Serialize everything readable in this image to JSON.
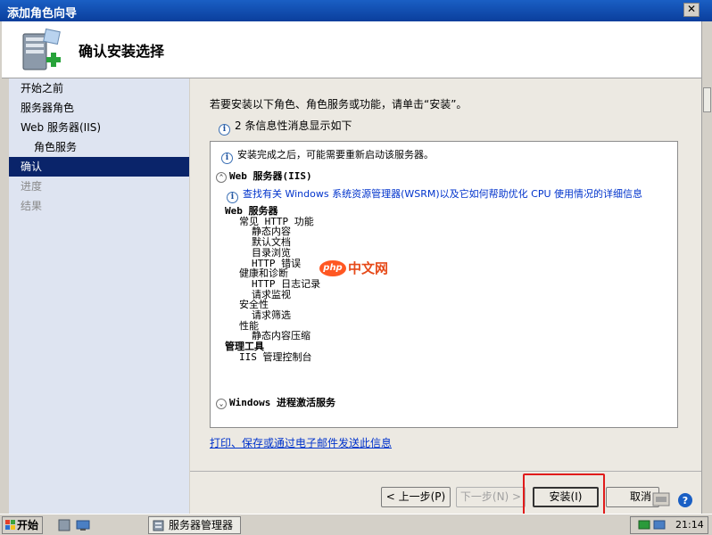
{
  "window": {
    "title": "添加角色向导",
    "close_glyph": "✕"
  },
  "header": {
    "title": "确认安装选择",
    "icon": "server-add-icon"
  },
  "nav": {
    "items": [
      {
        "label": "开始之前",
        "state": "normal"
      },
      {
        "label": "服务器角色",
        "state": "normal"
      },
      {
        "label": "Web 服务器(IIS)",
        "state": "normal"
      },
      {
        "label": "角色服务",
        "state": "sub"
      },
      {
        "label": "确认",
        "state": "active"
      },
      {
        "label": "进度",
        "state": "disabled"
      },
      {
        "label": "结果",
        "state": "disabled"
      }
    ]
  },
  "main": {
    "intro": "若要安装以下角色、角色服务或功能，请单击“安装”。",
    "info_count": "2 条信息性消息显示如下",
    "restart_note": "安装完成之后，可能需要重新启动该服务器。",
    "section_iis": "Web 服务器(IIS)",
    "wsrm_link": "查找有关 Windows 系统资源管理器(WSRM)以及它如何帮助优化 CPU 使用情况的详细信息",
    "tree": [
      {
        "level": 0,
        "text": "Web 服务器"
      },
      {
        "level": 1,
        "text": "常见 HTTP 功能"
      },
      {
        "level": 2,
        "text": "静态内容"
      },
      {
        "level": 2,
        "text": "默认文档"
      },
      {
        "level": 2,
        "text": "目录浏览"
      },
      {
        "level": 2,
        "text": "HTTP 错误"
      },
      {
        "level": 1,
        "text": "健康和诊断"
      },
      {
        "level": 2,
        "text": "HTTP 日志记录"
      },
      {
        "level": 2,
        "text": "请求监视"
      },
      {
        "level": 1,
        "text": "安全性"
      },
      {
        "level": 2,
        "text": "请求筛选"
      },
      {
        "level": 1,
        "text": "性能"
      },
      {
        "level": 2,
        "text": "静态内容压缩"
      },
      {
        "level": 0,
        "text": "管理工具"
      },
      {
        "level": 1,
        "text": "IIS 管理控制台"
      }
    ],
    "section_was": "Windows 进程激活服务",
    "print_link": "打印、保存或通过电子邮件发送此信息"
  },
  "footer": {
    "prev": "< 上一步(P)",
    "next": "下一步(N) >",
    "install": "安装(I)",
    "cancel": "取消"
  },
  "watermark": {
    "logo": "php",
    "text": "中文网"
  },
  "taskbar": {
    "start": "开始",
    "task": "服务器管理器",
    "clock": "21:14"
  },
  "colors": {
    "accent": "#0a246a",
    "highlight": "#e01b1b",
    "link": "#0033cc"
  }
}
